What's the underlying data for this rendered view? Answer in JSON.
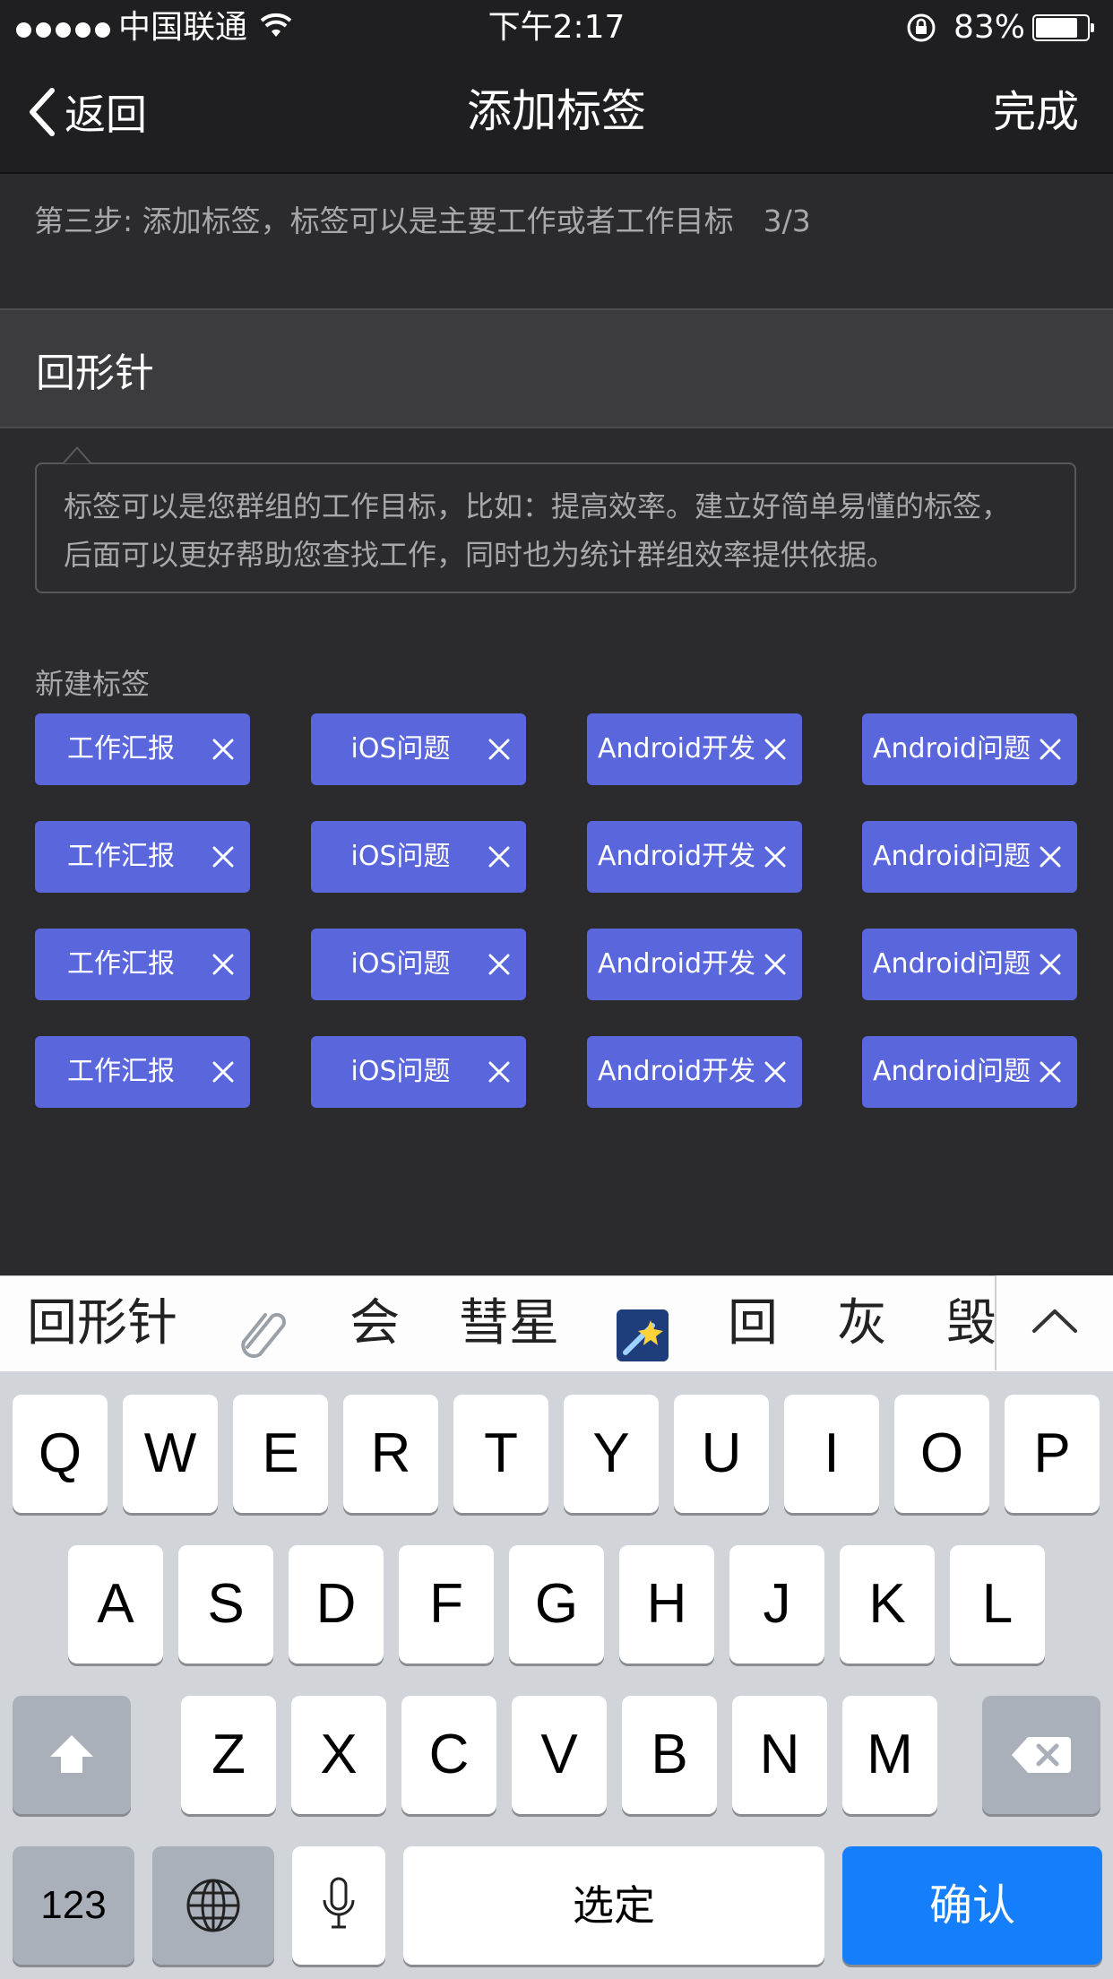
{
  "status_bar": {
    "carrier": "中国联通",
    "time": "下午2:17",
    "battery_percent": "83%",
    "battery_level": 0.83,
    "signal_bars": 5
  },
  "nav": {
    "back_label": "返回",
    "title": "添加标签",
    "done_label": "完成"
  },
  "step_hint": "第三步: 添加标签，标签可以是主要工作或者工作目标　3/3",
  "input": {
    "value": "回形针"
  },
  "tooltip": {
    "line1": "标签可以是您群组的工作目标，比如：提高效率。建立好简单易懂的标签，",
    "line2": "后面可以更好帮助您查找工作，同时也为统计群组效率提供依据。"
  },
  "tags_section": {
    "label": "新建标签",
    "tags": [
      "工作汇报",
      "iOS问题",
      "Android开发",
      "Android问题",
      "工作汇报",
      "iOS问题",
      "Android开发",
      "Android问题",
      "工作汇报",
      "iOS问题",
      "Android开发",
      "Android问题",
      "工作汇报",
      "iOS问题",
      "Android开发",
      "Android问题"
    ]
  },
  "candidates": {
    "first": "回形针",
    "emoji_1": "paperclip-icon",
    "c2": "会",
    "c3": "彗星",
    "emoji_2": "comet-icon",
    "c4": "回",
    "c5": "灰",
    "c6": "毁"
  },
  "keyboard": {
    "row1": [
      "Q",
      "W",
      "E",
      "R",
      "T",
      "Y",
      "U",
      "I",
      "O",
      "P"
    ],
    "row2": [
      "A",
      "S",
      "D",
      "F",
      "G",
      "H",
      "J",
      "K",
      "L"
    ],
    "row3": [
      "Z",
      "X",
      "C",
      "V",
      "B",
      "N",
      "M"
    ],
    "numbers_label": "123",
    "space_label": "选定",
    "confirm_label": "确认"
  },
  "colors": {
    "tag_bg": "#5a66dc",
    "confirm_bg": "#147efb",
    "page_bg": "#2b2b2d"
  }
}
